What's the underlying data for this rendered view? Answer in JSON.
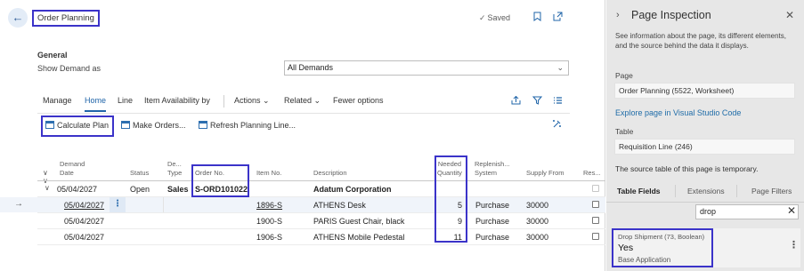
{
  "header": {
    "title": "Order Planning",
    "saved": "Saved"
  },
  "general": {
    "section_title": "General",
    "show_demand_label": "Show Demand as",
    "show_demand_value": "All Demands"
  },
  "actions": {
    "manage": "Manage",
    "home": "Home",
    "line": "Line",
    "item_availability": "Item Availability by",
    "actions": "Actions",
    "related": "Related",
    "fewer": "Fewer options"
  },
  "toolbar": {
    "calculate": "Calculate Plan",
    "make_orders": "Make Orders...",
    "refresh": "Refresh Planning Line..."
  },
  "grid": {
    "headers": {
      "demand_date": "Demand\nDate",
      "status": "Status",
      "demand_type": "De...\nType",
      "order_no": "Order No.",
      "item_no": "Item No.",
      "description": "Description",
      "needed_qty": "Needed\nQuantity",
      "replenish": "Replenish...\nSystem",
      "supply_from": "Supply From",
      "res": "Res..."
    },
    "group_row": {
      "date": "05/04/2027",
      "status": "Open",
      "type": "Sales",
      "order_no": "S-ORD101022",
      "description": "Adatum Corporation"
    },
    "rows": [
      {
        "date": "05/04/2027",
        "item_no": "1896-S",
        "description": "ATHENS Desk",
        "needed": "5",
        "system": "Purchase",
        "supply_from": "30000"
      },
      {
        "date": "05/04/2027",
        "item_no": "1900-S",
        "description": "PARIS Guest Chair, black",
        "needed": "9",
        "system": "Purchase",
        "supply_from": "30000"
      },
      {
        "date": "05/04/2027",
        "item_no": "1906-S",
        "description": "ATHENS Mobile Pedestal",
        "needed": "11",
        "system": "Purchase",
        "supply_from": "30000"
      }
    ]
  },
  "inspection": {
    "title": "Page Inspection",
    "description": "See information about the page, its different elements, and the source behind the data it displays.",
    "page_label": "Page",
    "page_value": "Order Planning (5522, Worksheet)",
    "explore_link": "Explore page in Visual Studio Code",
    "table_label": "Table",
    "table_value": "Requisition Line (246)",
    "table_note": "The source table of this page is temporary.",
    "tabs": [
      "Table Fields",
      "Extensions",
      "Page Filters"
    ],
    "search_value": "drop",
    "result": {
      "caption": "Drop Shipment (73, Boolean)",
      "value": "Yes",
      "source": "Base Application"
    }
  }
}
